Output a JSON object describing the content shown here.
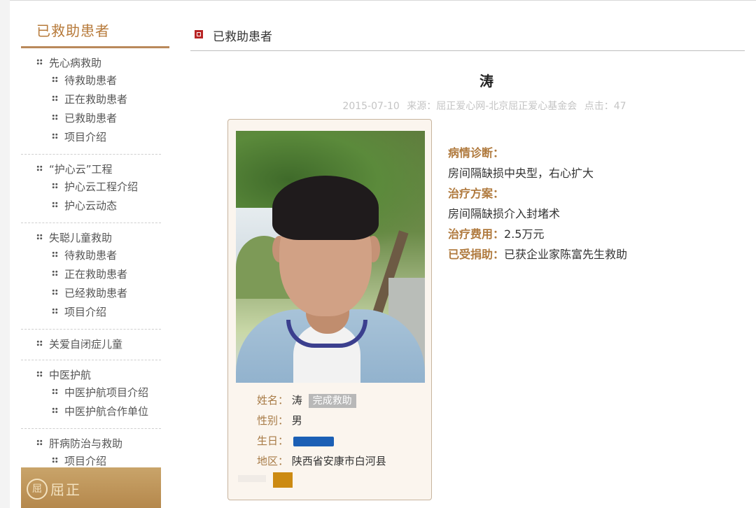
{
  "sidebar": {
    "title": "已救助患者",
    "groups": [
      {
        "label": "先心病救助",
        "items": [
          "待救助患者",
          "正在救助患者",
          "已救助患者",
          "项目介绍"
        ]
      },
      {
        "label": "“护心云”工程",
        "items": [
          "护心云工程介绍",
          "护心云动态"
        ]
      },
      {
        "label": "失聪儿童救助",
        "items": [
          "待救助患者",
          "正在救助患者",
          "已经救助患者",
          "项目介绍"
        ]
      },
      {
        "label": "关爱自闭症儿童",
        "items": []
      },
      {
        "label": "中医护航",
        "items": [
          "中医护航项目介绍",
          "中医护航合作单位"
        ]
      },
      {
        "label": "肝病防治与救助",
        "items": [
          "项目介绍"
        ]
      }
    ],
    "banner_text": "屈正"
  },
  "main": {
    "section_title": "已救助患者",
    "article_title": "涛",
    "meta": {
      "date": "2015-07-10",
      "source": "来源：屈正爱心网-北京屈正爱心基金会",
      "clicks": "点击：47"
    },
    "patient": {
      "name_label": "姓名：",
      "name_value": "涛",
      "status_badge": "完成救助",
      "gender_label": "性别：",
      "gender_value": "男",
      "birthday_label": "生日：",
      "birthday_value": "",
      "region_label": "地区：",
      "region_value": "陕西省安康市白河县"
    },
    "details": {
      "diagnosis_label": "病情诊断：",
      "diagnosis_text": "房间隔缺损中央型，右心扩大",
      "treatment_label": "治疗方案：",
      "treatment_text": "房间隔缺损介入封堵术",
      "cost_label": "治疗费用：",
      "cost_text": "2.5万元",
      "aid_label": "已受捐助：",
      "aid_text": "已获企业家陈富先生救助"
    }
  }
}
